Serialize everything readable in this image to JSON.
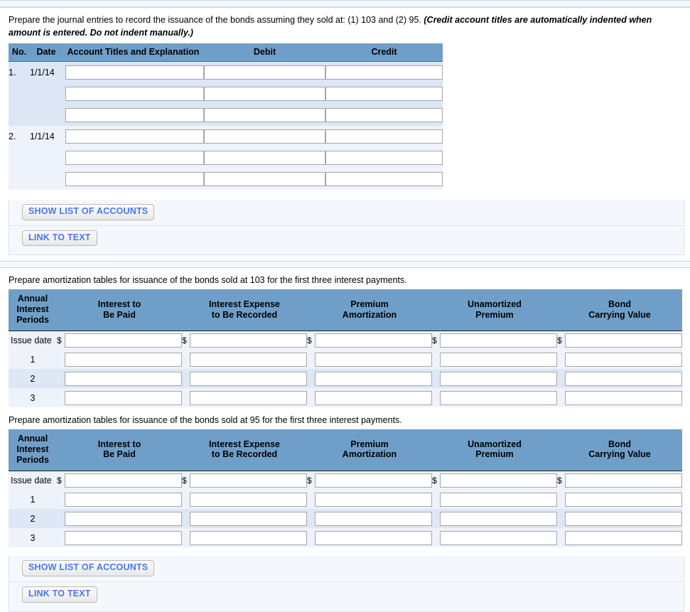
{
  "sections": {
    "journal": {
      "instruction_plain": "Prepare the journal entries to record the issuance of the bonds assuming they sold at: (1) 103 and (2) 95. ",
      "instruction_emphasis": "(Credit account titles are automatically indented when amount is entered. Do not indent manually.)",
      "columns": {
        "no": "No.",
        "date": "Date",
        "account": "Account Titles and Explanation",
        "debit": "Debit",
        "credit": "Credit"
      },
      "entries": [
        {
          "no": "1.",
          "date": "1/1/14",
          "lines": 3
        },
        {
          "no": "2.",
          "date": "1/1/14",
          "lines": 3
        }
      ],
      "buttons": {
        "show_list": "SHOW LIST OF ACCOUNTS",
        "link_to_text": "LINK TO TEXT"
      }
    },
    "amortization_103": {
      "instruction": "Prepare amortization tables for issuance of the bonds sold at 103 for the first three interest payments.",
      "columns": [
        "Annual\nInterest\nPeriods",
        "Interest to\nBe Paid",
        "Interest Expense\nto Be Recorded",
        "Premium\nAmortization",
        "Unamortized\nPremium",
        "Bond\nCarrying Value"
      ],
      "column_lines": {
        "periods": [
          "Annual",
          "Interest",
          "Periods"
        ],
        "col1": [
          "Interest to",
          "Be Paid"
        ],
        "col2": [
          "Interest Expense",
          "to Be Recorded"
        ],
        "col3": [
          "Premium",
          "Amortization"
        ],
        "col4": [
          "Unamortized",
          "Premium"
        ],
        "col5": [
          "Bond",
          "Carrying Value"
        ]
      },
      "rows": [
        {
          "label": "Issue date",
          "dollar": true
        },
        {
          "label": "1",
          "dollar": false
        },
        {
          "label": "2",
          "dollar": false
        },
        {
          "label": "3",
          "dollar": false
        }
      ],
      "dollar_symbol": "$"
    },
    "amortization_95": {
      "instruction": "Prepare amortization tables for issuance of the bonds sold at 95 for the first three interest payments.",
      "column_lines": {
        "periods": [
          "Annual",
          "Interest",
          "Periods"
        ],
        "col1": [
          "Interest to",
          "Be Paid"
        ],
        "col2": [
          "Interest Expense",
          "to Be Recorded"
        ],
        "col3": [
          "Premium",
          "Amortization"
        ],
        "col4": [
          "Unamortized",
          "Premium"
        ],
        "col5": [
          "Bond",
          "Carrying Value"
        ]
      },
      "rows": [
        {
          "label": "Issue date",
          "dollar": true
        },
        {
          "label": "1",
          "dollar": false
        },
        {
          "label": "2",
          "dollar": false
        },
        {
          "label": "3",
          "dollar": false
        }
      ],
      "dollar_symbol": "$",
      "buttons": {
        "show_list": "SHOW LIST OF ACCOUNTS",
        "link_to_text": "LINK TO TEXT"
      }
    }
  },
  "field_placeholder": "",
  "colors": {
    "header_blue": "#6f9fc8",
    "band_dark": "#dde6f4",
    "band_light": "#eef3fb",
    "button_text": "#4477ee"
  }
}
